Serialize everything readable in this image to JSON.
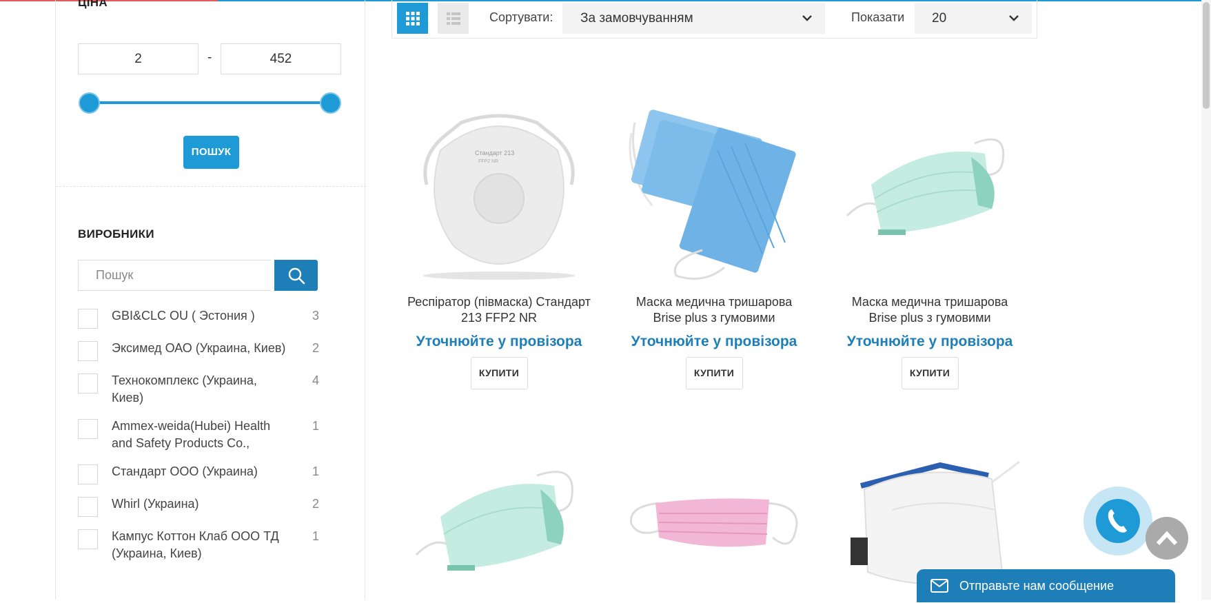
{
  "filters": {
    "price": {
      "title": "ЦІНА",
      "min": "2",
      "max": "452",
      "search_button": "ПОШУК"
    },
    "manufacturers": {
      "title": "ВИРОБНИКИ",
      "search_placeholder": "Пошук",
      "items": [
        {
          "label": "GBI&CLC OU ( Эстония )",
          "count": "3"
        },
        {
          "label": "Эксимед ОАО (Украина, Киев)",
          "count": "2"
        },
        {
          "label": "Технокомплекс (Украина, Киев)",
          "count": "4"
        },
        {
          "label": "Ammex-weida(Hubei) Health and Safety Products Co.,",
          "count": "1"
        },
        {
          "label": "Стандарт ООО (Украина)",
          "count": "1"
        },
        {
          "label": "Whirl (Украина)",
          "count": "2"
        },
        {
          "label": "Кампус Коттон Клаб ООО ТД (Украина, Киев)",
          "count": "1"
        }
      ]
    }
  },
  "toolbar": {
    "sort_label": "Сортувати:",
    "sort_value": "За замовчуванням",
    "show_label": "Показати",
    "show_value": "20"
  },
  "products": [
    {
      "name": "Респіратор (півмаска) Стандарт 213 FFP2 NR",
      "price": "Уточнюйте у провізора",
      "buy": "КУПИТИ"
    },
    {
      "name": "Маска медична тришарова Brise plus з гумовими",
      "price": "Уточнюйте у провізора",
      "buy": "КУПИТИ"
    },
    {
      "name": "Маска медична тришарова Brise plus з гумовими",
      "price": "Уточнюйте у провізора",
      "buy": "КУПИТИ"
    }
  ],
  "chat": {
    "label": "Отправьте нам сообщение"
  },
  "colors": {
    "accent": "#1e9bd7",
    "accent_dark": "#1e7fb8"
  }
}
